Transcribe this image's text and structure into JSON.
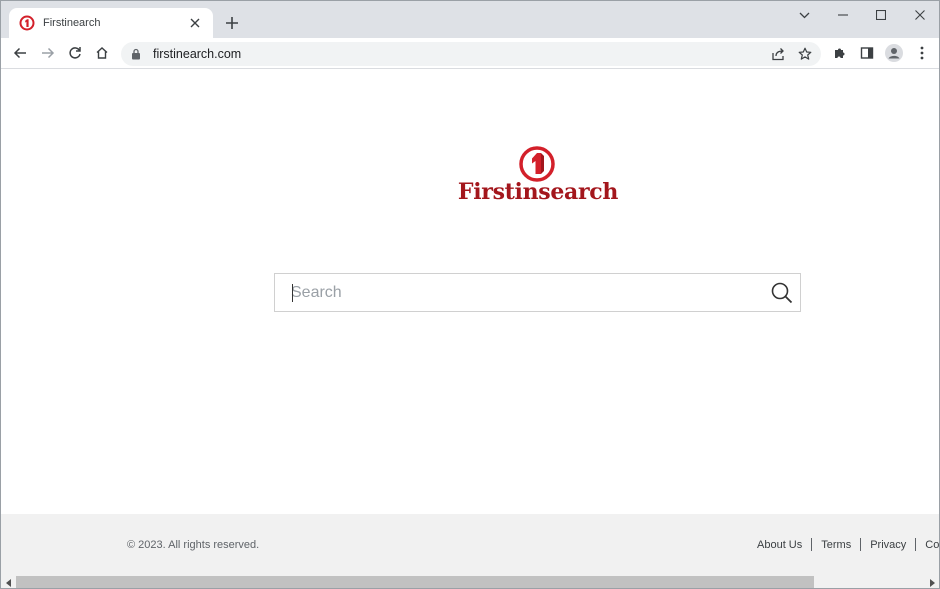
{
  "browser": {
    "tab_title": "Firstinearch",
    "url": "firstinearch.com"
  },
  "page": {
    "logo_text": "Firstinsearch",
    "search_placeholder": "Search"
  },
  "footer": {
    "copyright": "© 2023. All rights reserved.",
    "links": [
      "About Us",
      "Terms",
      "Privacy",
      "Conta"
    ]
  },
  "colors": {
    "brand_red": "#a3161c",
    "tab_strip": "#dee1e6",
    "footer_bg": "#f1f1f1"
  }
}
